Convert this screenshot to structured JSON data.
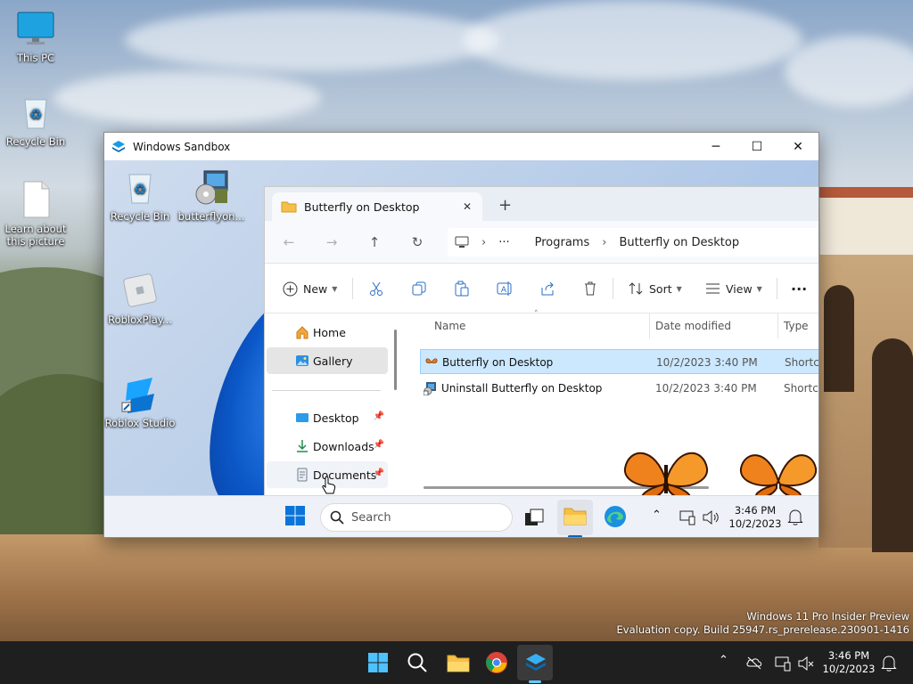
{
  "host_desktop": {
    "icons": [
      {
        "label": "This PC"
      },
      {
        "label": "Recycle Bin"
      },
      {
        "label": "Learn about this picture"
      }
    ],
    "watermark": {
      "line1": "Windows 11 Pro Insider Preview",
      "line2": "Evaluation copy. Build 25947.rs_prerelease.230901-1416"
    }
  },
  "sandbox": {
    "title": "Windows Sandbox",
    "controls": {
      "minimize": "─",
      "maximize": "☐",
      "close": "✕"
    },
    "desktop_icons": [
      {
        "label": "Recycle Bin"
      },
      {
        "label": "butterflyon..."
      },
      {
        "label": "RobloxPlay..."
      },
      {
        "label": "Roblox Studio"
      }
    ]
  },
  "explorer": {
    "tab_title": "Butterfly on Desktop",
    "tab_close": "✕",
    "new_tab": "+",
    "address": {
      "more": "···",
      "segments": [
        "Programs",
        "Butterfly on Desktop"
      ]
    },
    "commands": {
      "new": "New",
      "sort": "Sort",
      "view": "View",
      "more": "···"
    },
    "nav": {
      "items": [
        {
          "label": "Home",
          "icon": "home-icon"
        },
        {
          "label": "Gallery",
          "icon": "gallery-icon"
        },
        {
          "label": "Desktop",
          "icon": "desktop-icon"
        },
        {
          "label": "Downloads",
          "icon": "download-icon"
        },
        {
          "label": "Documents",
          "icon": "documents-icon"
        }
      ]
    },
    "columns": {
      "name": "Name",
      "date": "Date modified",
      "type": "Type"
    },
    "files": [
      {
        "name": "Butterfly on Desktop",
        "date": "10/2/2023 3:40 PM",
        "type": "Shortcut"
      },
      {
        "name": "Uninstall Butterfly on Desktop",
        "date": "10/2/2023 3:40 PM",
        "type": "Shortcut"
      }
    ]
  },
  "guest_taskbar": {
    "search_placeholder": "Search",
    "time": "3:46 PM",
    "date": "10/2/2023"
  },
  "host_taskbar": {
    "time": "3:46 PM",
    "date": "10/2/2023"
  },
  "colors": {
    "accent": "#0067c0",
    "selection": "#cce8ff",
    "taskbar_dark": "#1f1f1f",
    "indicator": "#60cdff"
  }
}
